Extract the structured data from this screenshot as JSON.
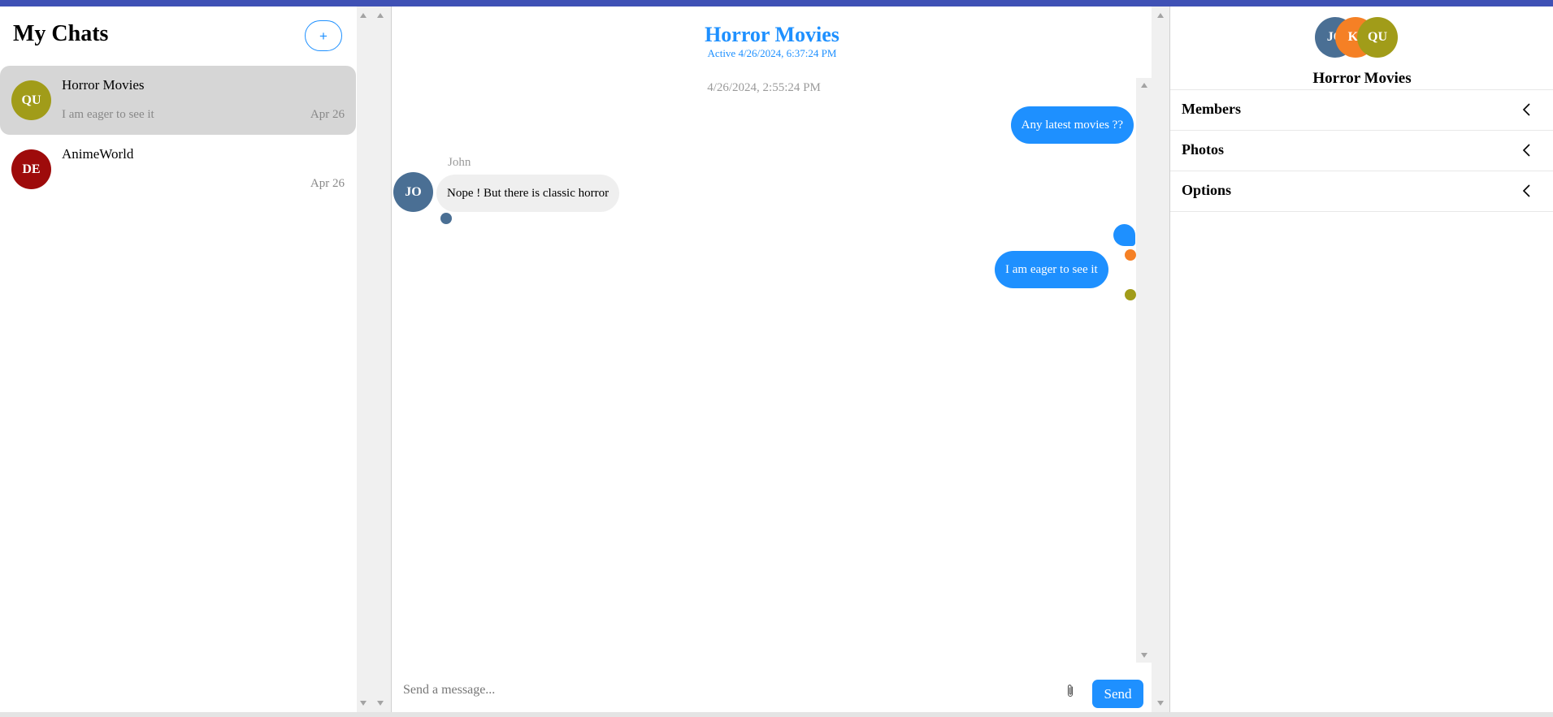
{
  "colors": {
    "accent": "#1e90ff",
    "topbar": "#3f51b5",
    "avatar_qu": "#a19c19",
    "avatar_de": "#9e0b0b",
    "avatar_jo": "#4a6f94",
    "avatar_k": "#f58025"
  },
  "sidebar": {
    "title": "My Chats",
    "new_chat_label": "+",
    "chats": [
      {
        "initials": "QU",
        "name": "Horror Movies",
        "preview": "I am eager to see it",
        "date": "Apr 26",
        "active": true
      },
      {
        "initials": "DE",
        "name": "AnimeWorld",
        "preview": "",
        "date": "Apr 26",
        "active": false
      }
    ]
  },
  "conversation": {
    "title": "Horror Movies",
    "status": "Active 4/26/2024, 6:37:24 PM",
    "timestamp": "4/26/2024, 2:55:24 PM",
    "messages": [
      {
        "from": "me",
        "text": "Any latest movies ??"
      },
      {
        "from": "John",
        "initials": "JO",
        "text": "Nope ! But there is classic horror"
      },
      {
        "from": "me",
        "text": ""
      },
      {
        "from": "me",
        "text": "I am eager to see it"
      }
    ],
    "composer": {
      "placeholder": "Send a message...",
      "attach_icon": "paperclip-icon",
      "send_label": "Send"
    }
  },
  "details": {
    "members": [
      "JO",
      "KI",
      "QU"
    ],
    "title": "Horror Movies",
    "sections": [
      {
        "label": "Members",
        "icon": "chevron-left-icon"
      },
      {
        "label": "Photos",
        "icon": "chevron-left-icon"
      },
      {
        "label": "Options",
        "icon": "chevron-left-icon"
      }
    ]
  }
}
